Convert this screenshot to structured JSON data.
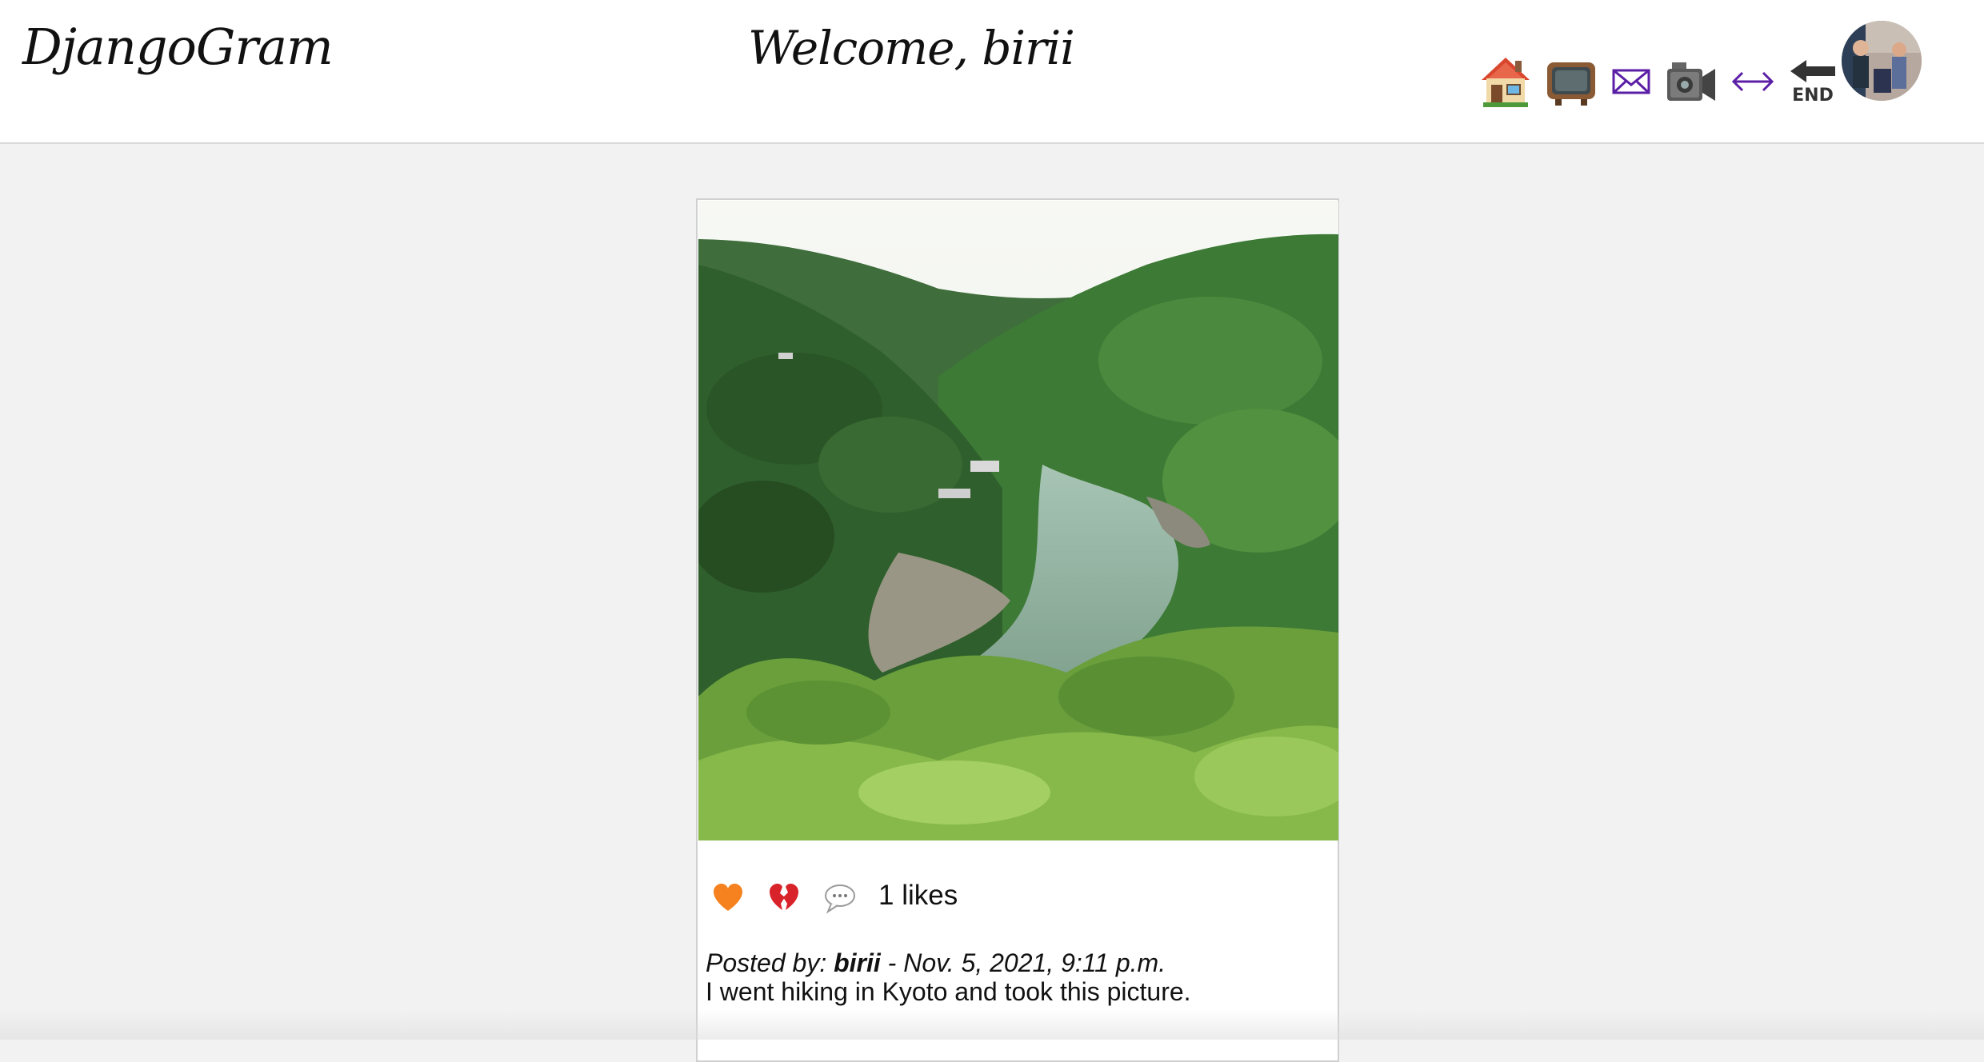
{
  "header": {
    "brand": "DjangoGram",
    "welcome": "Welcome, birii",
    "nav": {
      "home_icon": "house-icon",
      "tv_icon": "television-icon",
      "mail_icon": "envelope-icon",
      "video_icon": "video-camera-icon",
      "arrows_icon": "left-right-arrow-icon",
      "end_icon": "end-arrow-icon",
      "end_label": "END"
    },
    "avatar_icon": "profile-avatar"
  },
  "post": {
    "photo": "river-valley-photo",
    "like_icon": "orange-heart-icon",
    "unlike_icon": "broken-heart-icon",
    "comment_icon": "speech-bubble-icon",
    "likes_text": "1 likes",
    "posted_by_label": "Posted by:",
    "author": "birii",
    "separator": " - ",
    "date": "Nov. 5, 2021, 9:11 p.m.",
    "caption": "I went hiking in Kyoto and took this picture."
  },
  "colors": {
    "background": "#f2f2f2",
    "card": "#ffffff",
    "link_purple": "#5b1ea6"
  }
}
